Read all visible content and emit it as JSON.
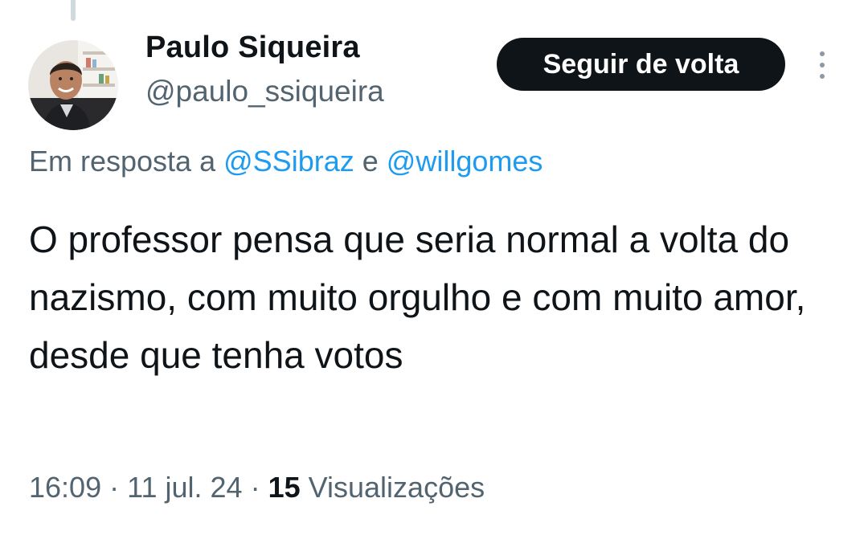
{
  "tweet": {
    "author": {
      "name": "Paulo Siqueira",
      "handle": "@paulo_ssiqueira"
    },
    "follow_button_label": "Seguir de volta",
    "reply_to": {
      "prefix": "Em resposta a",
      "mentions": [
        "@SSibraz",
        "@willgomes"
      ],
      "joiner": "e"
    },
    "text": "O professor pensa que seria normal a volta do nazismo, com muito orgulho e com muito amor, desde que tenha votos",
    "meta": {
      "time": "16:09",
      "date": "11 jul. 24",
      "separator": "·",
      "views_count": "15",
      "views_label": "Visualizações"
    }
  },
  "icons": {
    "more": "more-vertical-icon"
  },
  "colors": {
    "accent": "#1d9bf0",
    "button_bg": "#0f1419",
    "secondary_text": "#536471"
  }
}
